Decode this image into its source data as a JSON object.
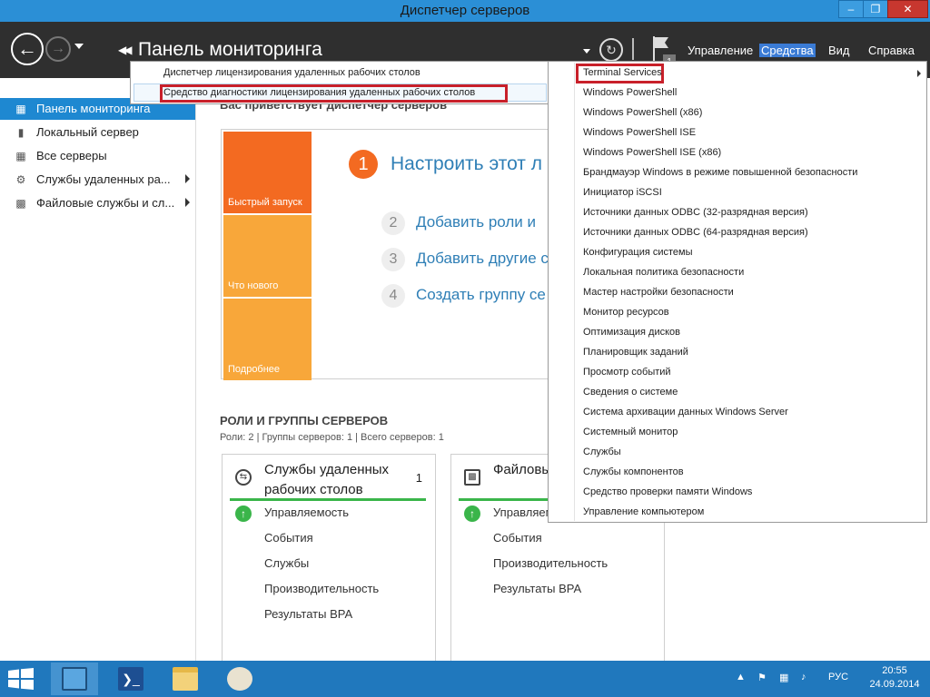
{
  "window": {
    "title": "Диспетчер серверов",
    "minimize": "–",
    "maximize": "❐",
    "close": "✕"
  },
  "header": {
    "page_title": "Панель мониторинга",
    "notification_count": "1",
    "menu": [
      "Управление",
      "Средства",
      "Вид",
      "Справка"
    ],
    "active_menu": "Средства"
  },
  "leftnav": {
    "items": [
      {
        "label": "Панель мониторинга",
        "icon": "dashboard-icon",
        "selected": true
      },
      {
        "label": "Локальный сервер",
        "icon": "server-icon"
      },
      {
        "label": "Все серверы",
        "icon": "servers-icon"
      },
      {
        "label": "Службы удаленных ра...",
        "icon": "remote-desktop-icon",
        "expandable": true
      },
      {
        "label": "Файловые службы и сл...",
        "icon": "file-services-icon",
        "expandable": true
      }
    ]
  },
  "main": {
    "welcome": "Вас приветствует диспетчер серверов",
    "tiles": [
      "Быстрый запуск",
      "Что нового",
      "Подробнее"
    ],
    "steps": [
      {
        "num": "1",
        "label": "Настроить этот л"
      },
      {
        "num": "2",
        "label": "Добавить роли и"
      },
      {
        "num": "3",
        "label": "Добавить другие с"
      },
      {
        "num": "4",
        "label": "Создать группу се"
      }
    ],
    "roles_title": "РОЛИ И ГРУППЫ СЕРВЕРОВ",
    "roles_sub": "Роли: 2 | Группы серверов: 1 | Всего серверов: 1",
    "cards": [
      {
        "title": "Службы удаленных рабочих столов",
        "count": "1",
        "rows": [
          "Управляемость",
          "События",
          "Службы",
          "Производительность",
          "Результаты BPA"
        ]
      },
      {
        "title": "Файловые службы",
        "count": "",
        "rows": [
          "Управляемость",
          "События",
          "Производительность",
          "Результаты BPA"
        ]
      }
    ]
  },
  "submenu": {
    "items": [
      "Диспетчер лицензирования удаленных рабочих столов",
      "Средство диагностики лицензирования удаленных рабочих столов"
    ]
  },
  "tools_menu": {
    "items": [
      "Terminal Services",
      "Windows PowerShell",
      "Windows PowerShell (x86)",
      "Windows PowerShell ISE",
      "Windows PowerShell ISE (x86)",
      "Брандмауэр Windows в режиме повышенной безопасности",
      "Инициатор iSCSI",
      "Источники данных ODBC (32-разрядная версия)",
      "Источники данных ODBC (64-разрядная версия)",
      "Конфигурация системы",
      "Локальная политика безопасности",
      "Мастер настройки безопасности",
      "Монитор ресурсов",
      "Оптимизация дисков",
      "Планировщик заданий",
      "Просмотр событий",
      "Сведения о системе",
      "Система архивации данных Windows Server",
      "Системный монитор",
      "Службы",
      "Службы компонентов",
      "Средство проверки памяти Windows",
      "Управление компьютером"
    ]
  },
  "taskbar": {
    "language": "РУС",
    "time": "20:55",
    "date": "24.09.2014"
  },
  "colors": {
    "titlebar": "#2b8fd6",
    "header": "#2f2f2f",
    "accent_orange": "#f36a21",
    "tile_light": "#f8a73a",
    "link_blue": "#2f7fb6",
    "highlight_red": "#c8202a",
    "ok_green": "#3ab54a",
    "taskbar": "#2078bd"
  }
}
